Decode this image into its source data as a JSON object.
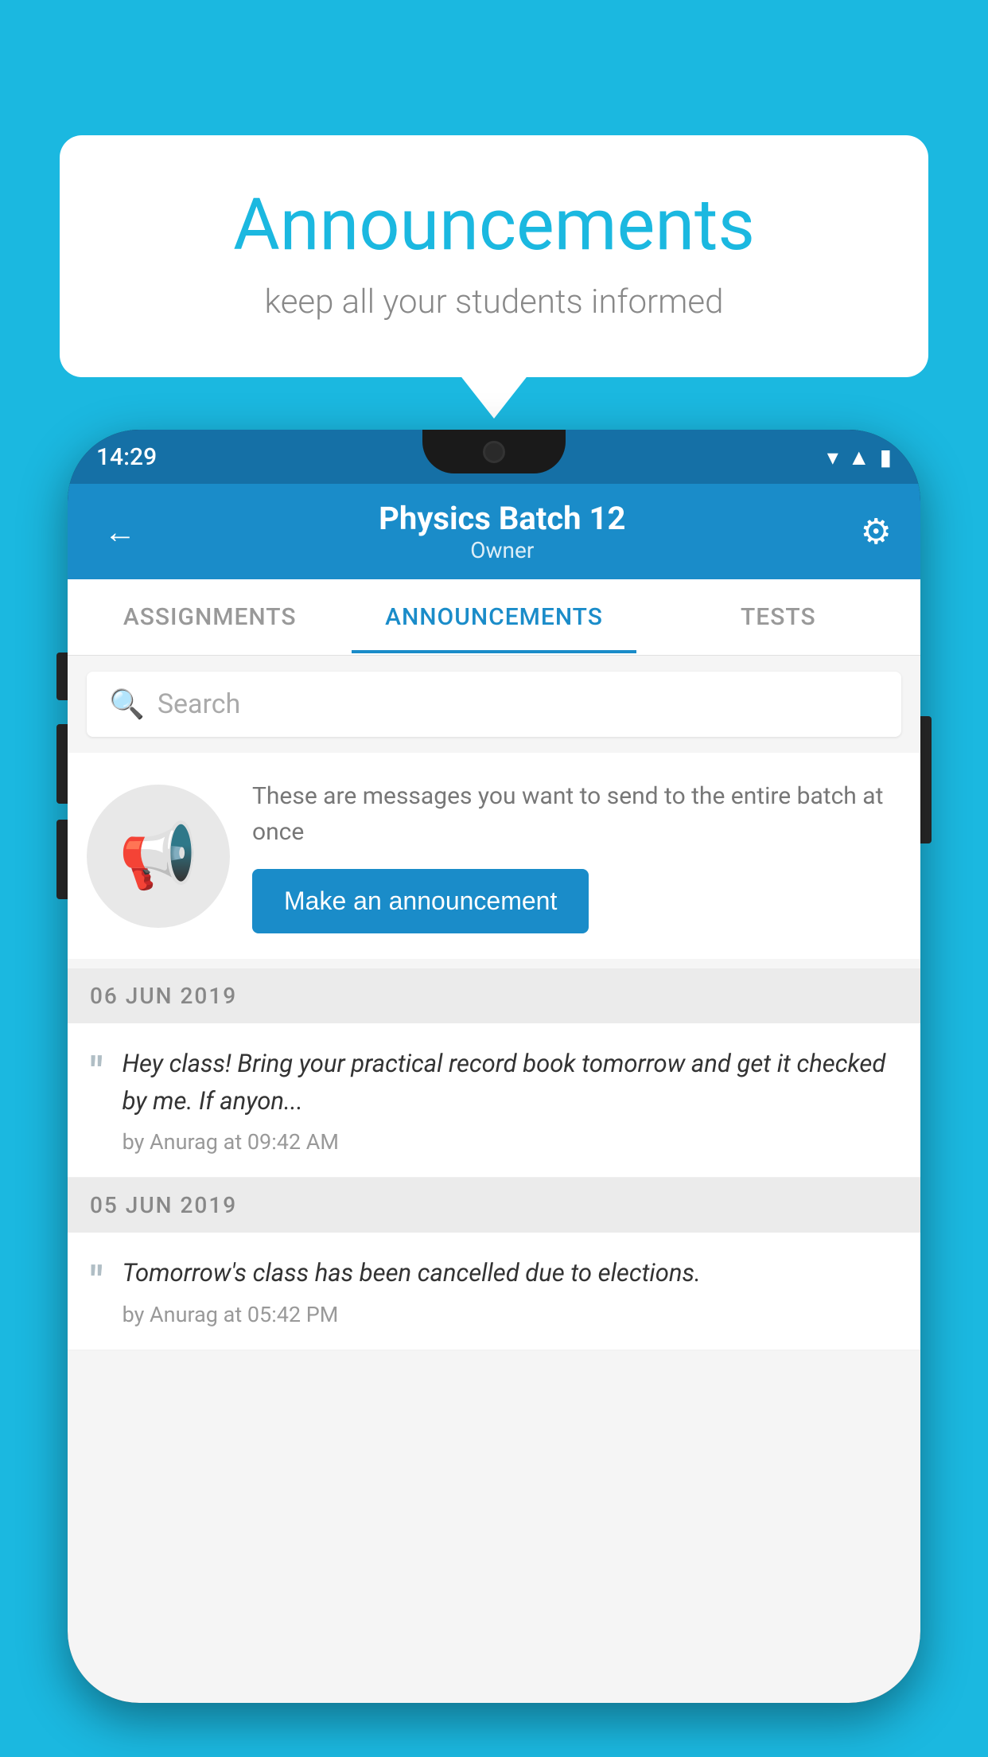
{
  "background_color": "#1bb8e0",
  "speech_bubble": {
    "title": "Announcements",
    "subtitle": "keep all your students informed"
  },
  "phone": {
    "status_bar": {
      "time": "14:29",
      "wifi_icon": "▾",
      "signal_icon": "▲",
      "battery_icon": "▮"
    },
    "header": {
      "title": "Physics Batch 12",
      "subtitle": "Owner",
      "back_label": "←",
      "settings_label": "⚙"
    },
    "tabs": [
      {
        "label": "ASSIGNMENTS",
        "active": false
      },
      {
        "label": "ANNOUNCEMENTS",
        "active": true
      },
      {
        "label": "TESTS",
        "active": false
      }
    ],
    "search": {
      "placeholder": "Search"
    },
    "cta": {
      "description": "These are messages you want to send to the entire batch at once",
      "button_label": "Make an announcement"
    },
    "announcements": [
      {
        "date": "06  JUN  2019",
        "text": "Hey class! Bring your practical record book tomorrow and get it checked by me. If anyon...",
        "meta": "by Anurag at 09:42 AM"
      },
      {
        "date": "05  JUN  2019",
        "text": "Tomorrow's class has been cancelled due to elections.",
        "meta": "by Anurag at 05:42 PM"
      }
    ]
  }
}
